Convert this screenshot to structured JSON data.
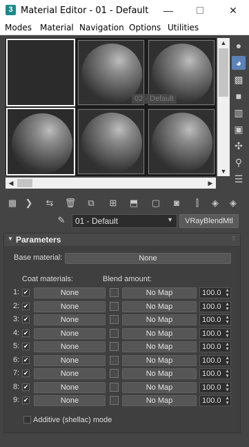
{
  "window": {
    "app_icon_char": "3",
    "title": "Material Editor - 01 - Default",
    "min_glyph": "—",
    "close_glyph": "✕"
  },
  "menubar": {
    "items": [
      "Modes",
      "Material",
      "Navigation",
      "Options",
      "Utilities"
    ]
  },
  "slots": {
    "tooltip": "02 - Default"
  },
  "material": {
    "name": "01 - Default",
    "type": "VRayBlendMtl"
  },
  "parameters": {
    "title": "Parameters",
    "base_material_label": "Base material:",
    "base_material_value": "None",
    "coat_materials_label": "Coat materials:",
    "blend_amount_label": "Blend amount:",
    "rows": [
      {
        "index": "1:",
        "coat": "None",
        "map": "No Map",
        "amount": "100.0"
      },
      {
        "index": "2:",
        "coat": "None",
        "map": "No Map",
        "amount": "100.0"
      },
      {
        "index": "3:",
        "coat": "None",
        "map": "No Map",
        "amount": "100.0"
      },
      {
        "index": "4:",
        "coat": "None",
        "map": "No Map",
        "amount": "100.0"
      },
      {
        "index": "5:",
        "coat": "None",
        "map": "No Map",
        "amount": "100.0"
      },
      {
        "index": "6:",
        "coat": "None",
        "map": "No Map",
        "amount": "100.0"
      },
      {
        "index": "7:",
        "coat": "None",
        "map": "No Map",
        "amount": "100.0"
      },
      {
        "index": "8:",
        "coat": "None",
        "map": "No Map",
        "amount": "100.0"
      },
      {
        "index": "9:",
        "coat": "None",
        "map": "No Map",
        "amount": "100.0"
      }
    ],
    "additive_label": "Additive (shellac) mode",
    "additive_checked": false
  },
  "colors": {
    "panel_bg": "#444444",
    "selected_tool": "#5b82b8",
    "titlebar_bg": "#ffffff"
  },
  "icons": {
    "side_tools": [
      "sample-type-icon",
      "backlight-icon",
      "background-checker-icon",
      "sample-uv-tiling-icon",
      "video-color-check-icon",
      "make-preview-icon",
      "options-icon",
      "select-by-material-icon",
      "material-map-navigator-icon"
    ],
    "bottom_tools": [
      "get-material-icon",
      "put-to-scene-icon",
      "assign-to-selection-icon",
      "reset-map-icon",
      "make-copy-icon",
      "make-unique-icon",
      "put-to-library-icon",
      "material-id-channel-icon",
      "show-shaded-icon",
      "show-end-result-icon",
      "go-to-parent-icon",
      "go-forward-icon"
    ]
  }
}
